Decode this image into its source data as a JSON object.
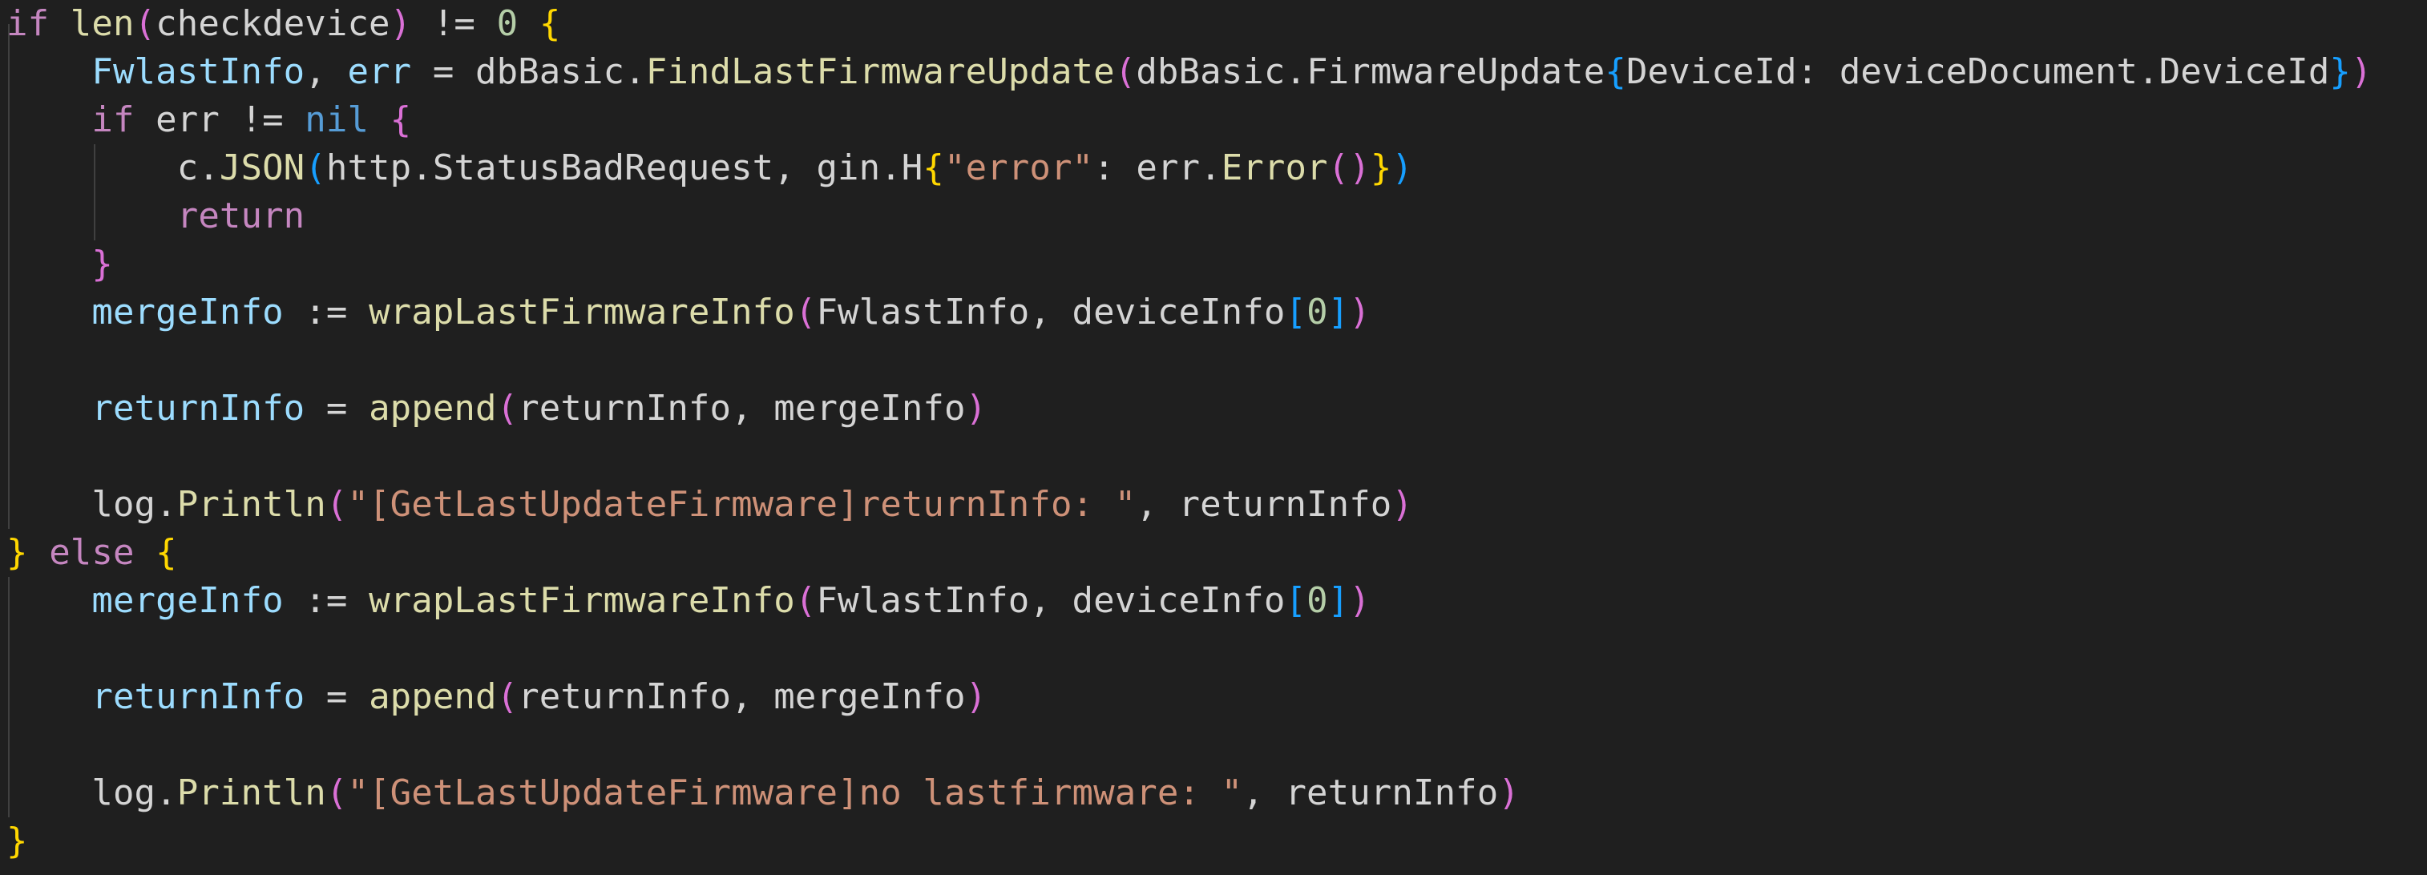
{
  "editor": {
    "language": "go",
    "theme": "dark",
    "colors": {
      "background": "#1f1f1f",
      "default_text": "#d4d4d4",
      "keyword": "#c586c0",
      "function": "#dcdcaa",
      "variable": "#9cdcfe",
      "string": "#ce9178",
      "number": "#b5cea8",
      "literal": "#569cd6",
      "bracket_level_1": "#ffd700",
      "bracket_level_2": "#da70d6",
      "bracket_level_3": "#179fff",
      "indent_guide": "#404040"
    },
    "lines": [
      [
        [
          "kw",
          "if"
        ],
        [
          "pl",
          " "
        ],
        [
          "fn",
          "len"
        ],
        [
          "b2",
          "("
        ],
        [
          "pl",
          "checkdevice"
        ],
        [
          "b2",
          ")"
        ],
        [
          "pl",
          " != "
        ],
        [
          "num",
          "0"
        ],
        [
          "pl",
          " "
        ],
        [
          "b1",
          "{"
        ]
      ],
      [
        [
          "pl",
          "    "
        ],
        [
          "var",
          "FwlastInfo"
        ],
        [
          "pl",
          ", "
        ],
        [
          "var",
          "err"
        ],
        [
          "pl",
          " = dbBasic."
        ],
        [
          "fn",
          "FindLastFirmwareUpdate"
        ],
        [
          "b2",
          "("
        ],
        [
          "pl",
          "dbBasic.FirmwareUpdate"
        ],
        [
          "b3",
          "{"
        ],
        [
          "pl",
          "DeviceId: deviceDocument.DeviceId"
        ],
        [
          "b3",
          "}"
        ],
        [
          "b2",
          ")"
        ]
      ],
      [
        [
          "pl",
          "    "
        ],
        [
          "kw",
          "if"
        ],
        [
          "pl",
          " err != "
        ],
        [
          "lit",
          "nil"
        ],
        [
          "pl",
          " "
        ],
        [
          "b2",
          "{"
        ]
      ],
      [
        [
          "pl",
          "        c."
        ],
        [
          "fn",
          "JSON"
        ],
        [
          "b3",
          "("
        ],
        [
          "pl",
          "http.StatusBadRequest, gin.H"
        ],
        [
          "b1",
          "{"
        ],
        [
          "str",
          "\"error\""
        ],
        [
          "pl",
          ": err."
        ],
        [
          "fn",
          "Error"
        ],
        [
          "b2",
          "()"
        ],
        [
          "b1",
          "}"
        ],
        [
          "b3",
          ")"
        ]
      ],
      [
        [
          "pl",
          "        "
        ],
        [
          "kw",
          "return"
        ]
      ],
      [
        [
          "pl",
          "    "
        ],
        [
          "b2",
          "}"
        ]
      ],
      [
        [
          "pl",
          "    "
        ],
        [
          "var",
          "mergeInfo"
        ],
        [
          "pl",
          " := "
        ],
        [
          "fn",
          "wrapLastFirmwareInfo"
        ],
        [
          "b2",
          "("
        ],
        [
          "pl",
          "FwlastInfo, deviceInfo"
        ],
        [
          "b3",
          "["
        ],
        [
          "num",
          "0"
        ],
        [
          "b3",
          "]"
        ],
        [
          "b2",
          ")"
        ]
      ],
      [],
      [
        [
          "pl",
          "    "
        ],
        [
          "var",
          "returnInfo"
        ],
        [
          "pl",
          " = "
        ],
        [
          "fn",
          "append"
        ],
        [
          "b2",
          "("
        ],
        [
          "pl",
          "returnInfo, mergeInfo"
        ],
        [
          "b2",
          ")"
        ]
      ],
      [],
      [
        [
          "pl",
          "    log."
        ],
        [
          "fn",
          "Println"
        ],
        [
          "b2",
          "("
        ],
        [
          "str",
          "\"[GetLastUpdateFirmware]returnInfo: \""
        ],
        [
          "pl",
          ", returnInfo"
        ],
        [
          "b2",
          ")"
        ]
      ],
      [
        [
          "b1",
          "}"
        ],
        [
          "pl",
          " "
        ],
        [
          "kw",
          "else"
        ],
        [
          "pl",
          " "
        ],
        [
          "b1",
          "{"
        ]
      ],
      [
        [
          "pl",
          "    "
        ],
        [
          "var",
          "mergeInfo"
        ],
        [
          "pl",
          " := "
        ],
        [
          "fn",
          "wrapLastFirmwareInfo"
        ],
        [
          "b2",
          "("
        ],
        [
          "pl",
          "FwlastInfo, deviceInfo"
        ],
        [
          "b3",
          "["
        ],
        [
          "num",
          "0"
        ],
        [
          "b3",
          "]"
        ],
        [
          "b2",
          ")"
        ]
      ],
      [],
      [
        [
          "pl",
          "    "
        ],
        [
          "var",
          "returnInfo"
        ],
        [
          "pl",
          " = "
        ],
        [
          "fn",
          "append"
        ],
        [
          "b2",
          "("
        ],
        [
          "pl",
          "returnInfo, mergeInfo"
        ],
        [
          "b2",
          ")"
        ]
      ],
      [],
      [
        [
          "pl",
          "    log."
        ],
        [
          "fn",
          "Println"
        ],
        [
          "b2",
          "("
        ],
        [
          "str",
          "\"[GetLastUpdateFirmware]no lastfirmware: \""
        ],
        [
          "pl",
          ", returnInfo"
        ],
        [
          "b2",
          ")"
        ]
      ],
      [
        [
          "b1",
          "}"
        ]
      ]
    ]
  }
}
